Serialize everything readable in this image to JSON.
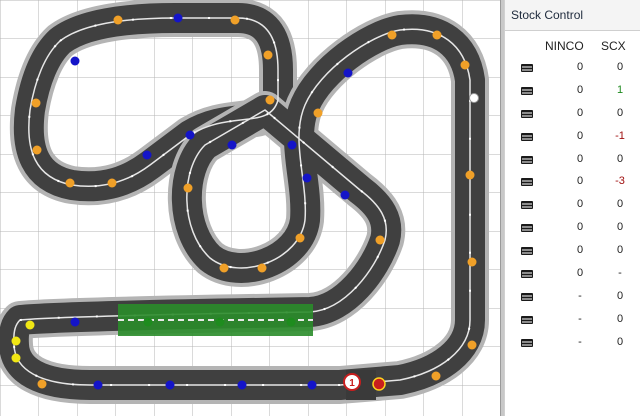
{
  "panel": {
    "title": "Stock Control",
    "columns": [
      "NINCO",
      "SCX"
    ]
  },
  "stock_rows": [
    {
      "icon": "straight-double-piece-icon",
      "ninco": "0",
      "scx": "0",
      "scx_color": "normal"
    },
    {
      "icon": "straight-standard-piece-icon",
      "ninco": "0",
      "scx": "1",
      "scx_color": "positive"
    },
    {
      "icon": "straight-half-piece-icon",
      "ninco": "0",
      "scx": "0",
      "scx_color": "normal"
    },
    {
      "icon": "straight-quarter-piece-icon",
      "ninco": "0",
      "scx": "-1",
      "scx_color": "negative"
    },
    {
      "icon": "crossing-piece-icon",
      "ninco": "0",
      "scx": "0",
      "scx_color": "normal"
    },
    {
      "icon": "curve-small-piece-icon",
      "ninco": "0",
      "scx": "-3",
      "scx_color": "negative"
    },
    {
      "icon": "curve-standard-piece-icon",
      "ninco": "0",
      "scx": "0",
      "scx_color": "normal"
    },
    {
      "icon": "curve-wide-piece-icon",
      "ninco": "0",
      "scx": "0",
      "scx_color": "normal"
    },
    {
      "icon": "curve-extra-wide-piece-icon",
      "ninco": "0",
      "scx": "0",
      "scx_color": "normal"
    },
    {
      "icon": "curve-outer-piece-icon",
      "ninco": "0",
      "scx": "-",
      "scx_color": "normal"
    },
    {
      "icon": "curve-border-piece-icon",
      "ninco": "-",
      "scx": "0",
      "scx_color": "normal"
    },
    {
      "icon": "curve-half-piece-icon",
      "ninco": "-",
      "scx": "0",
      "scx_color": "normal"
    },
    {
      "icon": "straight-border-piece-icon",
      "ninco": "-",
      "scx": "0",
      "scx_color": "normal"
    }
  ],
  "track": {
    "start_marker_label": "1",
    "colors": {
      "track": "#404040",
      "border": "#b4b4b4",
      "lane": "#e6e6e6",
      "straight_marker": "#1414c8",
      "curve_marker": "#f0a028",
      "lane_change_marker": "#1e8c1e",
      "lane_change_pad": "#2a8c2a",
      "tight_curve_marker": "#f0e614",
      "start_marker": "#c81e1e",
      "grid": "#b4b4b4"
    }
  }
}
